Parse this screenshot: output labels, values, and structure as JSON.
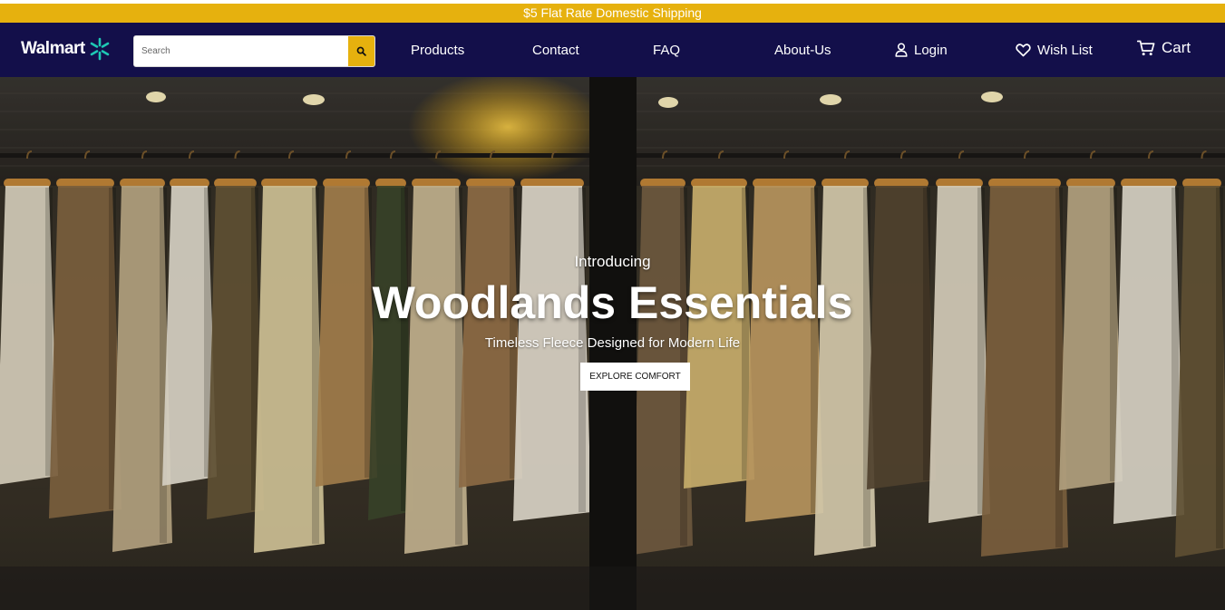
{
  "promo": {
    "text": "$5 Flat Rate Domestic Shipping"
  },
  "brand": {
    "name": "Walmart",
    "spark_color": "#1ec8b4"
  },
  "search": {
    "placeholder": "Search",
    "value": ""
  },
  "nav": {
    "products": "Products",
    "contact": "Contact",
    "faq": "FAQ",
    "about": "About-Us",
    "login": "Login",
    "wishlist": "Wish List",
    "cart": "Cart"
  },
  "hero": {
    "intro": "Introducing",
    "headline": "Woodlands Essentials",
    "subline": "Timeless Fleece Designed for Modern Life",
    "cta": "EXPLORE COMFORT"
  },
  "colors": {
    "promo_bar": "#e6b10e",
    "navbar": "#130f4a",
    "accent": "#e6b10e"
  },
  "icons": [
    "spark-icon",
    "search-icon",
    "user-icon",
    "heart-icon",
    "cart-icon"
  ]
}
